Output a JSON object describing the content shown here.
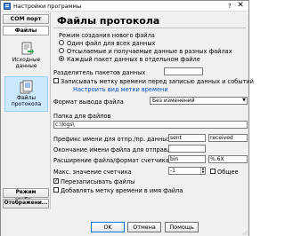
{
  "window": {
    "title": "Настройки программы",
    "close": "✕",
    "help": "?"
  },
  "sidebar": {
    "top_button": "COM порт",
    "active_button": "Файлы",
    "items": [
      {
        "label": "Исходные данные"
      },
      {
        "label": "Файлы протокола"
      }
    ],
    "bottom_buttons": [
      "Режим отобр...",
      "Отображени..."
    ]
  },
  "main": {
    "title": "Файлы протокола",
    "mode_group_label": "Режим создания нового файла",
    "mode_options": [
      "Один файл для всех данных",
      "Отсылаемые и получаемые данные в разных файлах",
      "Каждый пакет данных в отдельном файле"
    ],
    "packet_separator_label": "Разделитель пакетов данных",
    "packet_separator_value": "",
    "write_timestamp_label": "Записывать метку времени перед записью данных и событий",
    "timestamp_link": "Настроить вид метки времени",
    "output_format_label": "Формат вывода файла",
    "output_format_value": "Без изменений",
    "folder_label": "Папка для файлов",
    "folder_value": "c:\\logs\\",
    "prefix_label": "Префикс имени для отпр./пр. данных",
    "prefix_sent": "sent",
    "prefix_received": "received",
    "suffix_label": "Окончание имени файла для отправленных",
    "suffix_value": "",
    "ext_label": "Расширение файла/формат счетчика",
    "ext_value": "bin",
    "counter_format_value": "%.6X",
    "max_counter_label": "Макс. значение счетчика",
    "max_counter_value": "-1",
    "common_label": "Общее",
    "overwrite_label": "Перезаписывать файлы",
    "add_timestamp_name_label": "Добавлять метку времени в имя файла"
  },
  "buttons": {
    "ok": "OK",
    "cancel": "Отмена",
    "help": "Помощь"
  }
}
